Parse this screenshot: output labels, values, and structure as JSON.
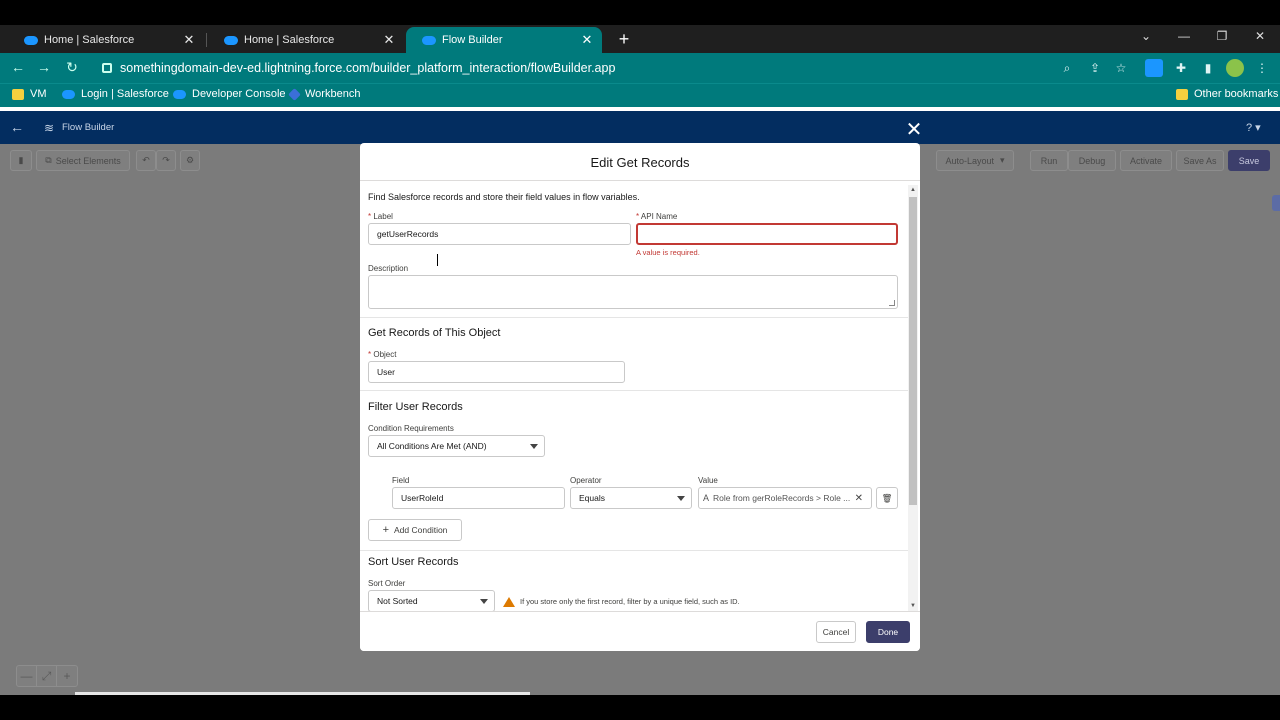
{
  "browser": {
    "tabs": [
      {
        "title": "Home | Salesforce"
      },
      {
        "title": "Home | Salesforce"
      },
      {
        "title": "Flow Builder"
      }
    ],
    "new_tab": "+",
    "url": "somethingdomain-dev-ed.lightning.force.com/builder_platform_interaction/flowBuilder.app",
    "bookmarks": [
      "VM",
      "Login | Salesforce",
      "Developer Console",
      "Workbench"
    ],
    "other_bookmarks": "Other bookmarks"
  },
  "app": {
    "title": "Flow Builder",
    "help": "? ▾"
  },
  "flow_toolbar": {
    "select_elements": "Select Elements",
    "auto_layout": "Auto-Layout",
    "run": "Run",
    "debug": "Debug",
    "activate": "Activate",
    "save_as": "Save As",
    "save": "Save"
  },
  "modal": {
    "title": "Edit Get Records",
    "description_text": "Find Salesforce records and store their field values in flow variables.",
    "label": {
      "label": "Label",
      "value": "getUserRecords"
    },
    "api_name": {
      "label": "API Name",
      "value": "",
      "error": "A value is required."
    },
    "description": {
      "label": "Description",
      "value": ""
    },
    "object_section": {
      "title": "Get Records of This Object",
      "object_label": "Object",
      "object_value": "User"
    },
    "filter_section": {
      "title": "Filter User Records",
      "condition_label": "Condition Requirements",
      "condition_value": "All Conditions Are Met (AND)",
      "field_label": "Field",
      "field_value": "UserRoleId",
      "operator_label": "Operator",
      "operator_value": "Equals",
      "value_label": "Value",
      "value_value": "Role from gerRoleRecords > Role ...",
      "add_condition": "Add Condition"
    },
    "sort_section": {
      "title": "Sort User Records",
      "sort_label": "Sort Order",
      "sort_value": "Not Sorted",
      "note": "If you store only the first record, filter by a unique field, such as ID."
    },
    "cancel": "Cancel",
    "done": "Done"
  },
  "colors": {
    "chrome_teal": "#007a7c",
    "sf_header": "#032d60",
    "brand_button": "#3c3e6b",
    "error": "#c23934",
    "warning": "#dd7a01"
  }
}
